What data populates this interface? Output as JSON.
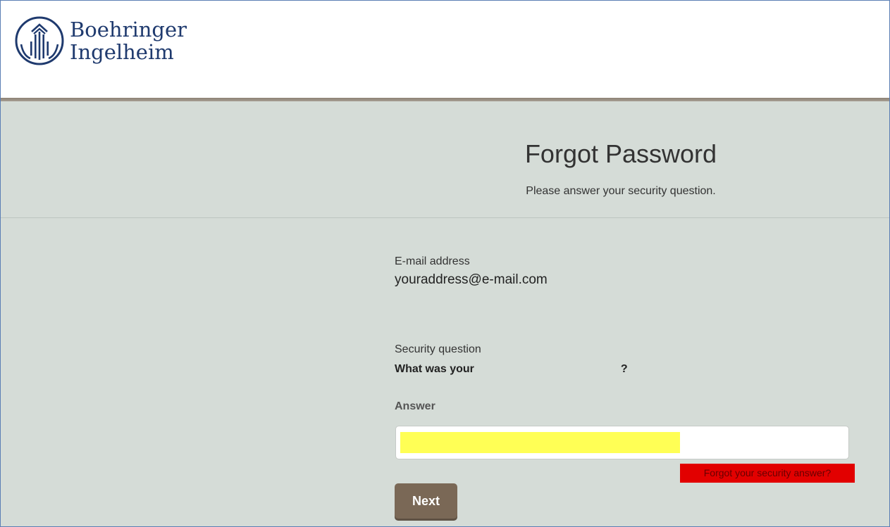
{
  "header": {
    "logo_line1": "Boehringer",
    "logo_line2": "Ingelheim",
    "brand_color": "#1f3a6e"
  },
  "page": {
    "title": "Forgot Password",
    "subtitle": "Please answer your security question."
  },
  "form": {
    "email_label": "E-mail address",
    "email_value": "youraddress@e-mail.com",
    "security_label": "Security question",
    "question_prefix": "What was your",
    "question_suffix": "?",
    "answer_label": "Answer",
    "answer_value": "",
    "forgot_link": "Forgot your security answer?",
    "next_button": "Next"
  },
  "colors": {
    "page_background": "#d5dcd7",
    "button": "#7a6856",
    "highlight": "#ffff55",
    "forgot_link_background": "#e20000"
  }
}
